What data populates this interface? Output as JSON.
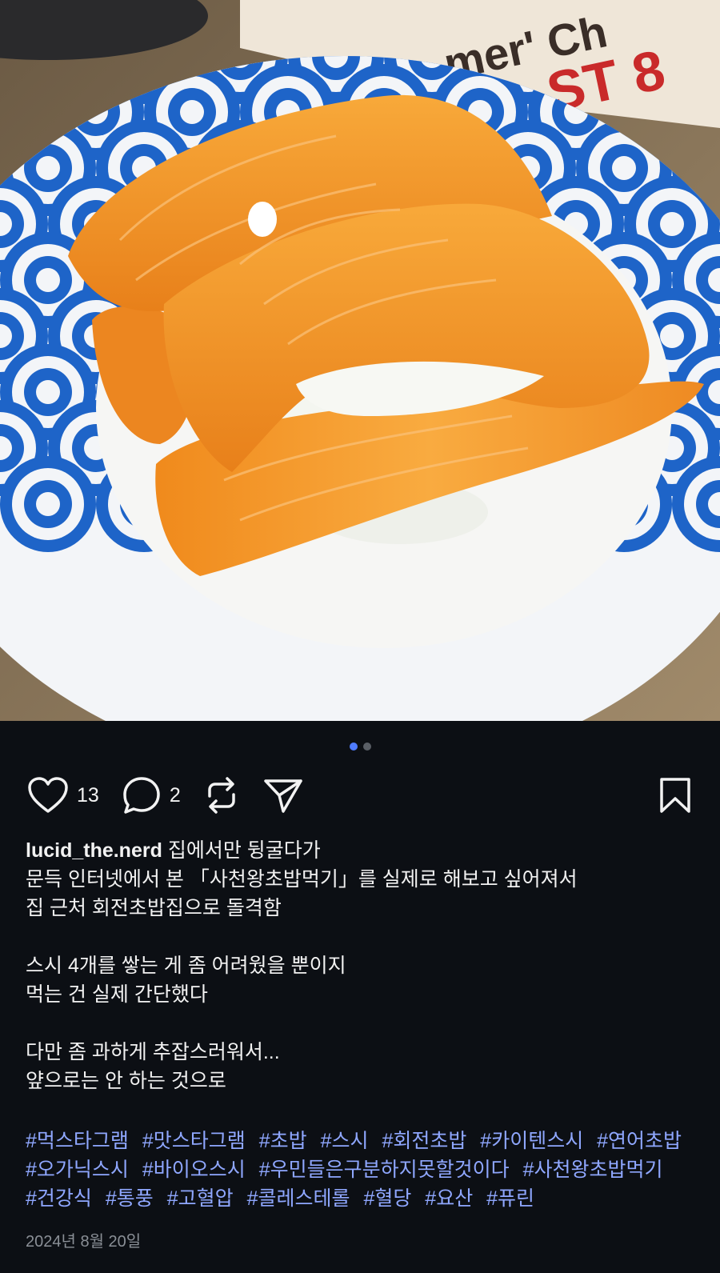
{
  "post": {
    "image": {
      "plate_pattern_color": "#1e64c8",
      "plate_background": "#f3f5f8",
      "salmon_color": "#f59a1e",
      "menu_text": "mer' Ch",
      "menu_number": "ST 8"
    },
    "carousel": {
      "total": 2,
      "current": 1
    },
    "actions": {
      "like_icon": "heart-icon",
      "like_count": "13",
      "comment_icon": "comment-bubble-icon",
      "comment_count": "2",
      "repost_icon": "repost-icon",
      "share_icon": "paper-plane-icon",
      "save_icon": "bookmark-icon"
    },
    "caption": {
      "username": "lucid_the.nerd",
      "lines": [
        "집에서만 뒹굴다가",
        "문득 인터넷에서 본 「사천왕초밥먹기」를 실제로 해보고 싶어져서",
        "집 근처 회전초밥집으로 돌격함",
        "",
        "스시 4개를 쌓는 게 좀 어려웠을 뿐이지",
        "먹는 건 실제 간단했다",
        "",
        "다만 좀 과하게 추잡스러워서...",
        "얖으로는 안 하는 것으로"
      ]
    },
    "hashtags": [
      "#먹스타그램",
      "#맛스타그램",
      "#초밥",
      "#스시",
      "#회전초밥",
      "#카이텐스시",
      "#연어초밥",
      "#오가닉스시",
      "#바이오스시",
      "#우민들은구분하지못할것이다",
      "#사천왕초밥먹기",
      "#건강식",
      "#통풍",
      "#고혈압",
      "#콜레스테롤",
      "#혈당",
      "#요산",
      "#퓨린"
    ],
    "date": "2024년 8월 20일",
    "colors": {
      "background": "#0c0f14",
      "text": "#f2f2f2",
      "hashtag": "#8fa7ff",
      "date": "#8a8f96",
      "active_dot": "#4f7cff"
    }
  }
}
